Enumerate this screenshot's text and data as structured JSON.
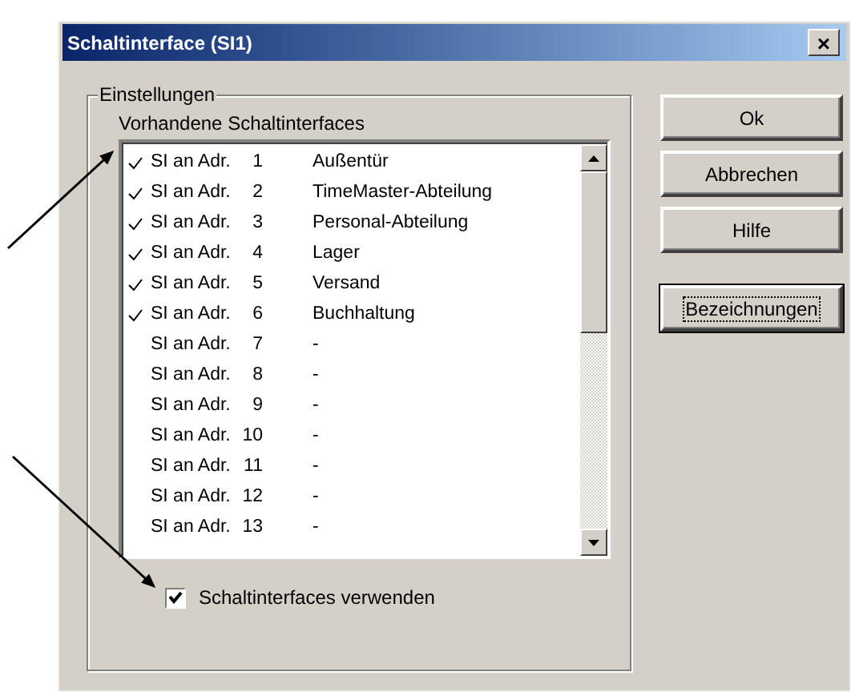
{
  "window": {
    "title": "Schaltinterface (SI1)",
    "close": "×"
  },
  "group": {
    "title": "Einstellungen",
    "list_label": "Vorhandene Schaltinterfaces",
    "rows": [
      {
        "checked": true,
        "label": "SI an Adr.",
        "number": "1",
        "name": "Außentür"
      },
      {
        "checked": true,
        "label": "SI an Adr.",
        "number": "2",
        "name": "TimeMaster-Abteilung"
      },
      {
        "checked": true,
        "label": "SI an Adr.",
        "number": "3",
        "name": "Personal-Abteilung"
      },
      {
        "checked": true,
        "label": "SI an Adr.",
        "number": "4",
        "name": "Lager"
      },
      {
        "checked": true,
        "label": "SI an Adr.",
        "number": "5",
        "name": "Versand"
      },
      {
        "checked": true,
        "label": "SI an Adr.",
        "number": "6",
        "name": "Buchhaltung"
      },
      {
        "checked": false,
        "label": "SI an Adr.",
        "number": "7",
        "name": "-"
      },
      {
        "checked": false,
        "label": "SI an Adr.",
        "number": "8",
        "name": "-"
      },
      {
        "checked": false,
        "label": "SI an Adr.",
        "number": "9",
        "name": "-"
      },
      {
        "checked": false,
        "label": "SI an Adr.",
        "number": "10",
        "name": "-"
      },
      {
        "checked": false,
        "label": "SI an Adr.",
        "number": "11",
        "name": "-"
      },
      {
        "checked": false,
        "label": "SI an Adr.",
        "number": "12",
        "name": "-"
      },
      {
        "checked": false,
        "label": "SI an Adr.",
        "number": "13",
        "name": "-"
      }
    ],
    "use_checkbox": {
      "label": "Schaltinterfaces verwenden",
      "checked": true
    }
  },
  "buttons": [
    {
      "label": "Ok",
      "focused": false
    },
    {
      "label": "Abbrechen",
      "focused": false
    },
    {
      "label": "Hilfe",
      "focused": false
    },
    {
      "label": "Bezeichnungen",
      "focused": true
    }
  ]
}
